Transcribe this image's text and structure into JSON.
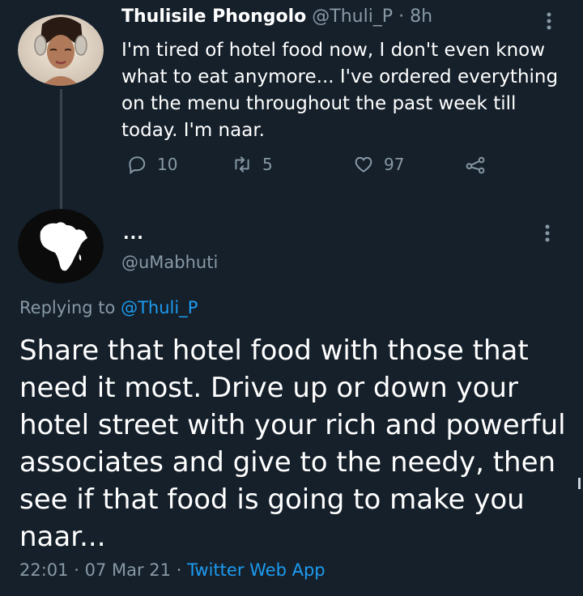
{
  "tweet": {
    "author_name": "Thulisile Phongolo",
    "author_handle": "@Thuli_P",
    "separator": "·",
    "time_ago": "8h",
    "text": "I'm tired of hotel food now, I don't even know what to eat anymore... I've ordered everything on the menu throughout the past week till today. I'm naar.",
    "more_label": "⋮",
    "actions": {
      "replies": "10",
      "retweets": "5",
      "likes": "97"
    }
  },
  "reply": {
    "author_name": "...",
    "author_handle": "@uMabhuti",
    "more_label": "⋮",
    "replying_to_label": "Replying to",
    "replying_to_handle": "@Thuli_P",
    "text": "Share that hotel food with those that need it most. Drive up or down your hotel street with your rich and powerful associates and give to the needy, then see if that food is going to make you naar...",
    "time": "22:01",
    "separator": "·",
    "date": "07 Mar 21",
    "source": "Twitter Web App"
  },
  "colors": {
    "background": "#15202b",
    "text_primary": "#ffffff",
    "text_secondary": "#8899a6",
    "link": "#1d9bf0",
    "thread_line": "#38444d"
  },
  "icons": [
    "reply-icon",
    "retweet-icon",
    "like-icon",
    "share-icon",
    "more-icon",
    "africa-map-avatar"
  ]
}
